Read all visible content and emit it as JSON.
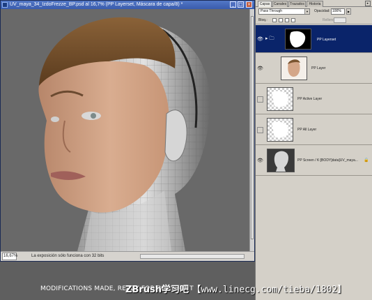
{
  "document": {
    "title": "UV_maya_34_IzdoFrezze_BP.psd al 16,7% (PP Layerset, Máscara de capa/8) *",
    "zoom": "16,67%",
    "status_message": "La exposición sólo funciona con 32 bits"
  },
  "panel": {
    "tabs": [
      "Capas",
      "Canales",
      "Trazados",
      "Historia"
    ],
    "blend_mode": "Pass Through",
    "opacity_label": "Opacidad:",
    "opacity_value": "100%",
    "lock_label": "Bloq.:",
    "fill_label": "Relleno:"
  },
  "layers": [
    {
      "name": "PP Layerset",
      "selected": true
    },
    {
      "name": "PP Layer",
      "selected": false
    },
    {
      "name": "PP Active Layer",
      "selected": false
    },
    {
      "name": "PP All Layer",
      "selected": false
    },
    {
      "name": "PP Screen / K:[BODY]data]UV_maya...",
      "selected": false
    }
  ],
  "caption": "MODIFICATIONS MADE, READY FOR BODYPAINT",
  "watermark": {
    "brand": "ZBrush学习吧",
    "site": "【www.linecg.com/tieba/1802】"
  }
}
